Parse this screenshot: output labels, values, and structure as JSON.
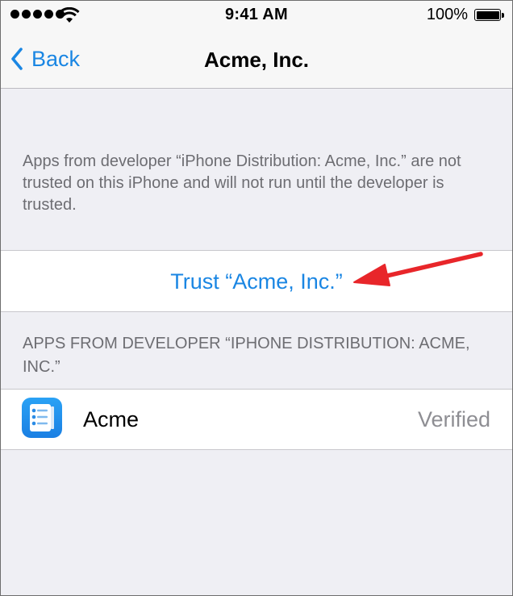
{
  "status_bar": {
    "time": "9:41 AM",
    "battery_percent": "100%",
    "signal_bars": 5,
    "icons": [
      "signal-dots-icon",
      "wifi-icon",
      "battery-icon"
    ]
  },
  "nav": {
    "back_label": "Back",
    "title": "Acme, Inc."
  },
  "explanation": "Apps from developer “iPhone Distribution: Acme, Inc.” are not trusted on this iPhone and will not run until the developer is trusted.",
  "trust_button": "Trust “Acme, Inc.”",
  "apps_section": {
    "header": "APPS FROM DEVELOPER “IPHONE DISTRIBUTION: ACME, INC.”",
    "apps": [
      {
        "name": "Acme",
        "status": "Verified",
        "icon": "checklist-app-icon"
      }
    ]
  },
  "colors": {
    "accent": "#1a86e3",
    "background": "#efeff4",
    "secondary_text": "#6d6d72",
    "annotation_arrow": "#e8262a"
  }
}
